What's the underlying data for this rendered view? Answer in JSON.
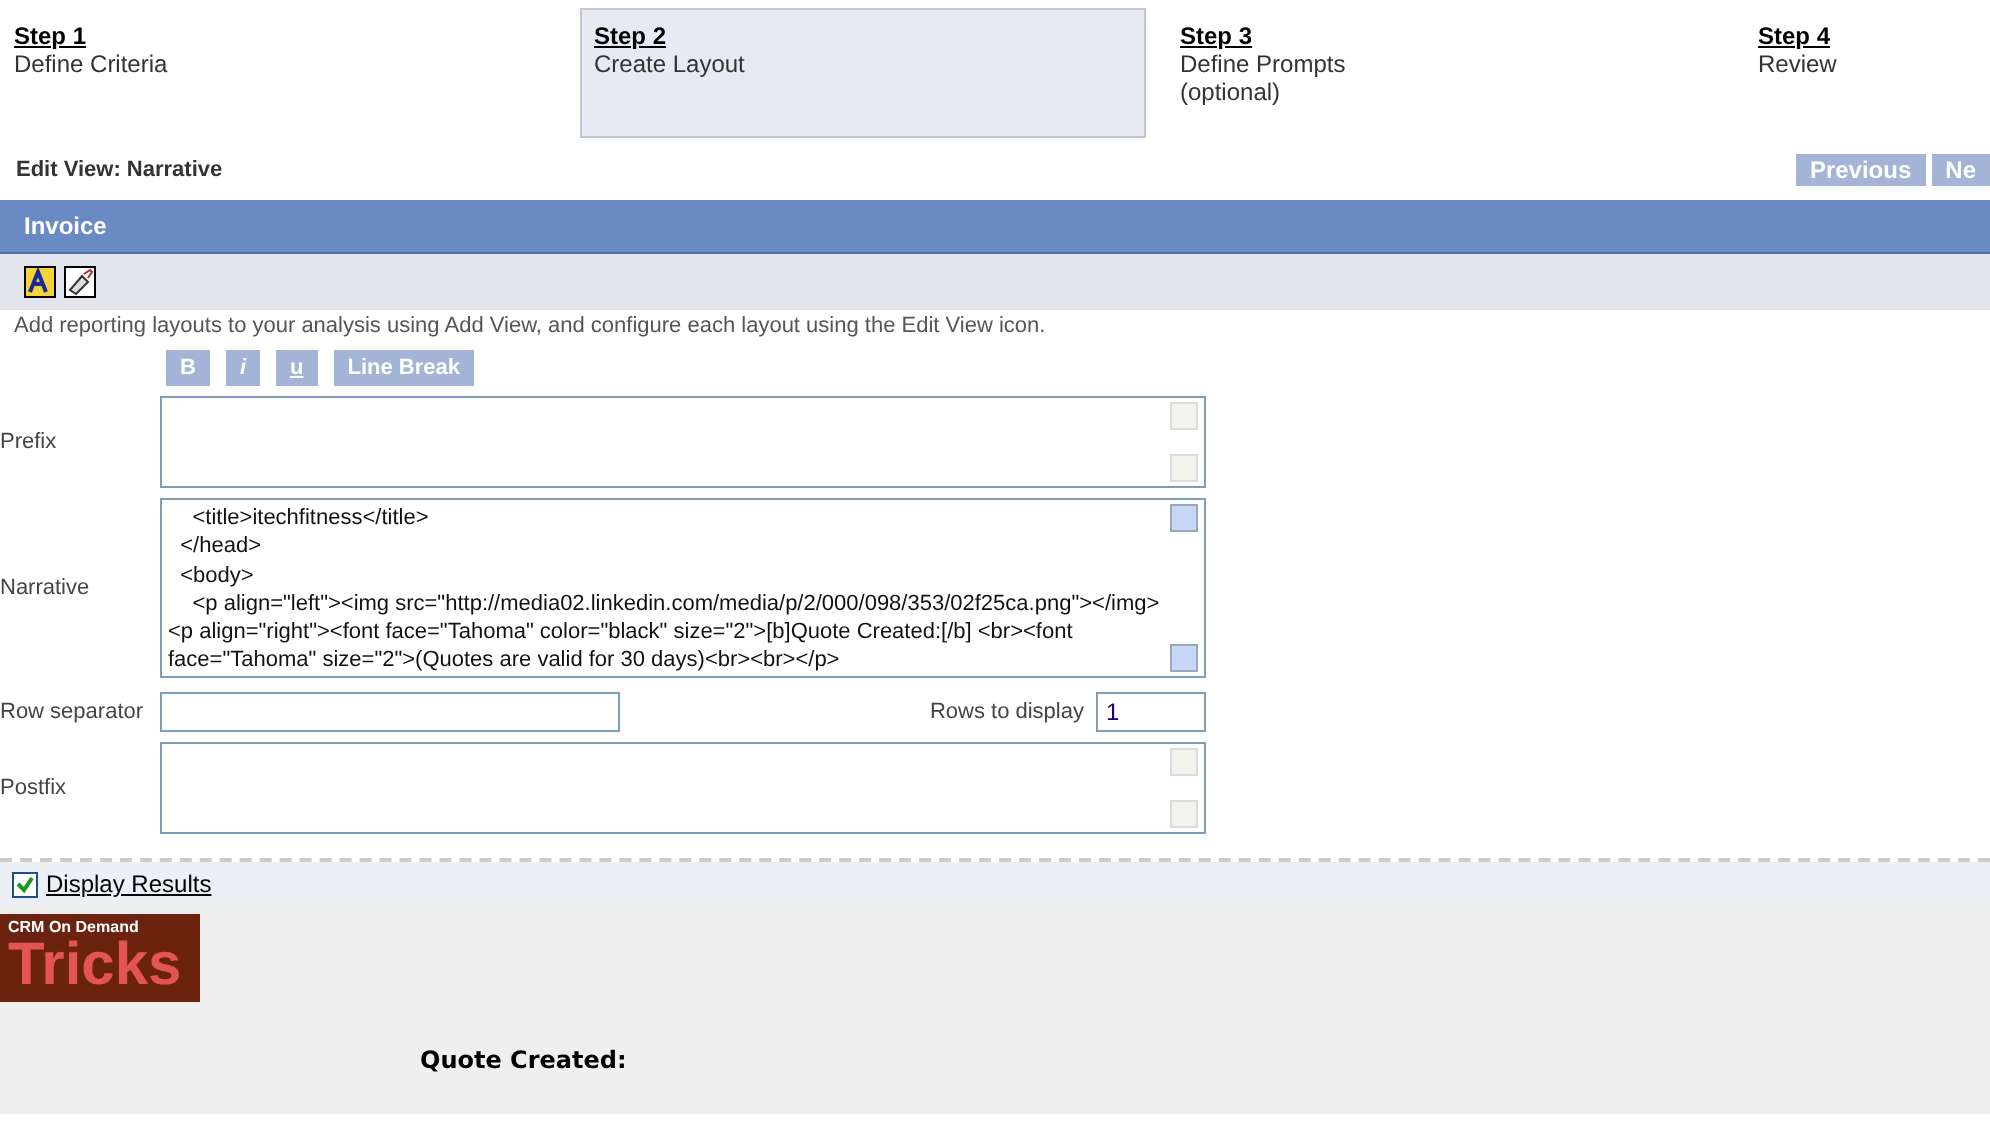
{
  "steps": [
    {
      "title": "Step 1",
      "label": "Define Criteria",
      "selected": false
    },
    {
      "title": "Step 2",
      "label": "Create Layout",
      "selected": true
    },
    {
      "title": "Step 3",
      "label": "Define Prompts (optional)",
      "selected": false
    },
    {
      "title": "Step 4",
      "label": "Review",
      "selected": false
    }
  ],
  "edit_view_title": "Edit View: Narrative",
  "nav_buttons": [
    "Previous",
    "Ne"
  ],
  "panel_title": "Invoice",
  "hint": "Add reporting layouts to your analysis using Add View, and configure each layout using the Edit View icon.",
  "format_buttons": [
    {
      "label": "B",
      "kind": "bold"
    },
    {
      "label": "i",
      "kind": "italic"
    },
    {
      "label": "u",
      "kind": "underline"
    },
    {
      "label": "Line Break",
      "kind": "plain"
    }
  ],
  "prefix": {
    "label": "Prefix"
  },
  "narrative": {
    "label": "Narrative",
    "lines": [
      "    <title>itechfitness</title>",
      "  </head>",
      "  <body>",
      "    <p align=\"left\"><img src=\"http://media02.linkedin.com/media/p/2/000/098/353/02f25ca.png\"></img>",
      "<p align=\"right\"><font face=\"Tahoma\" color=\"black\" size=\"2\">[b]Quote Created:[/b] <br><font",
      "face=\"Tahoma\" size=\"2\">(Quotes are valid for 30 days)<br><br></p>"
    ]
  },
  "row_separator": {
    "label": "Row separator"
  },
  "rows_to_display": {
    "label": "Rows to display",
    "value": "1"
  },
  "postfix": {
    "label": "Postfix"
  },
  "display_results": {
    "label": "Display Results",
    "checked": true
  },
  "preview": {
    "logo_small": "CRM On Demand",
    "logo_big": "Tricks",
    "heading": "Quote Created:"
  }
}
